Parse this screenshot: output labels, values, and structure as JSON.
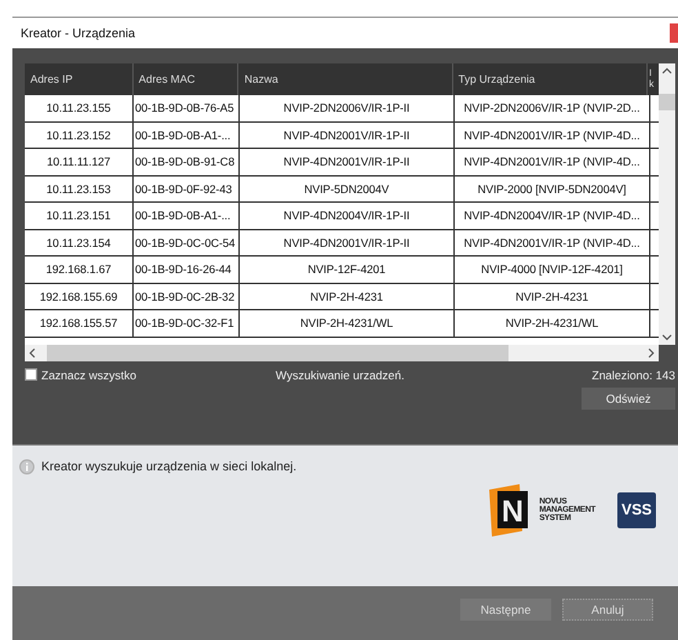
{
  "window": {
    "title": "Kreator - Urządzenia"
  },
  "table": {
    "columns": [
      "Adres IP",
      "Adres MAC",
      "Nazwa",
      "Typ Urządzenia",
      "I k"
    ],
    "rows": [
      [
        "10.11.23.155",
        "00-1B-9D-0B-76-A5",
        "NVIP-2DN2006V/IR-1P-II",
        "NVIP-2DN2006V/IR-1P (NVIP-2D..."
      ],
      [
        "10.11.23.152",
        "00-1B-9D-0B-A1-...",
        "NVIP-4DN2001V/IR-1P-II",
        "NVIP-4DN2001V/IR-1P (NVIP-4D..."
      ],
      [
        "10.11.11.127",
        "00-1B-9D-0B-91-C8",
        "NVIP-4DN2001V/IR-1P-II",
        "NVIP-4DN2001V/IR-1P (NVIP-4D..."
      ],
      [
        "10.11.23.153",
        "00-1B-9D-0F-92-43",
        "NVIP-5DN2004V",
        "NVIP-2000 [NVIP-5DN2004V]"
      ],
      [
        "10.11.23.151",
        "00-1B-9D-0B-A1-...",
        "NVIP-4DN2004V/IR-1P-II",
        "NVIP-4DN2004V/IR-1P (NVIP-4D..."
      ],
      [
        "10.11.23.154",
        "00-1B-9D-0C-0C-54",
        "NVIP-4DN2001V/IR-1P-II",
        "NVIP-4DN2001V/IR-1P (NVIP-4D..."
      ],
      [
        "192.168.1.67",
        "00-1B-9D-16-26-44",
        "NVIP-12F-4201",
        "NVIP-4000 [NVIP-12F-4201]"
      ],
      [
        "192.168.155.69",
        "00-1B-9D-0C-2B-32",
        "NVIP-2H-4231",
        "NVIP-2H-4231"
      ],
      [
        "192.168.155.57",
        "00-1B-9D-0C-32-F1",
        "NVIP-2H-4231/WL",
        "NVIP-2H-4231/WL"
      ]
    ]
  },
  "select_all": {
    "label": "Zaznacz wszystko",
    "checked": false
  },
  "status": "Wyszukiwanie urzadzeń.",
  "found": "Znaleziono: 143",
  "refresh_button": "Odśwież",
  "info": "Kreator wyszukuje urządzenia w sieci lokalnej.",
  "logo": {
    "mark": "N",
    "lines": [
      "NOVUS",
      "MANAGEMENT",
      "SYSTEM"
    ],
    "badge": "VSS"
  },
  "buttons": [
    "Następne",
    "Anuluj"
  ]
}
